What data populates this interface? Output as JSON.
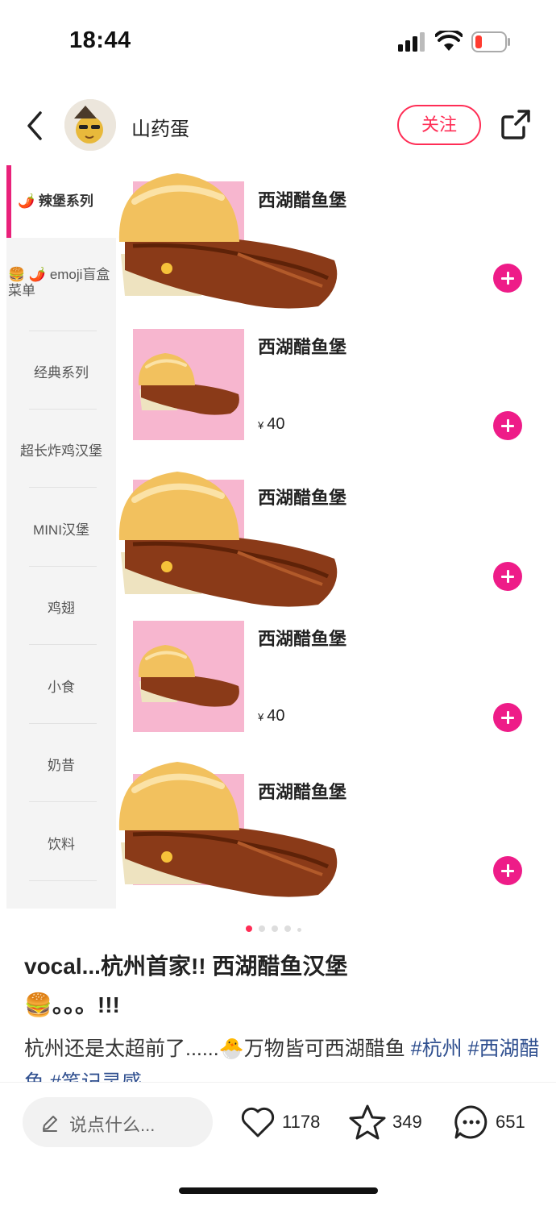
{
  "status_bar": {
    "time": "18:44"
  },
  "header": {
    "author": "山药蛋",
    "follow_label": "关注"
  },
  "menu": {
    "categories": [
      "辣堡系列",
      "emoji盲盒菜单",
      "经典系列",
      "超长炸鸡汉堡",
      "MINI汉堡",
      "鸡翅",
      "小食",
      "奶昔",
      "饮料"
    ],
    "cat_emoji": {
      "chili": "🌶️",
      "burger": "🍔"
    },
    "items": [
      {
        "name": "西湖醋鱼堡",
        "price": ""
      },
      {
        "name": "西湖醋鱼堡",
        "price": "40",
        "currency": "¥"
      },
      {
        "name": "西湖醋鱼堡",
        "price": ""
      },
      {
        "name": "西湖醋鱼堡",
        "price": "40",
        "currency": "¥"
      },
      {
        "name": "西湖醋鱼堡",
        "price": ""
      }
    ]
  },
  "post": {
    "title_line1": "vocal...杭州首家!!  西湖醋鱼汉堡",
    "title_line2": "🍔。。。!!!",
    "body_text": "杭州还是太超前了......🐣万物皆可西湖醋鱼 ",
    "tags": [
      "#杭州",
      "#西湖醋鱼",
      "#笔记灵感"
    ]
  },
  "bottom_bar": {
    "comment_placeholder": "说点什么...",
    "likes": "1178",
    "favorites": "349",
    "comments": "651"
  },
  "colors": {
    "accent": "#ff2d55",
    "add_button": "#ee1c88",
    "tag": "#2f4f8f"
  }
}
